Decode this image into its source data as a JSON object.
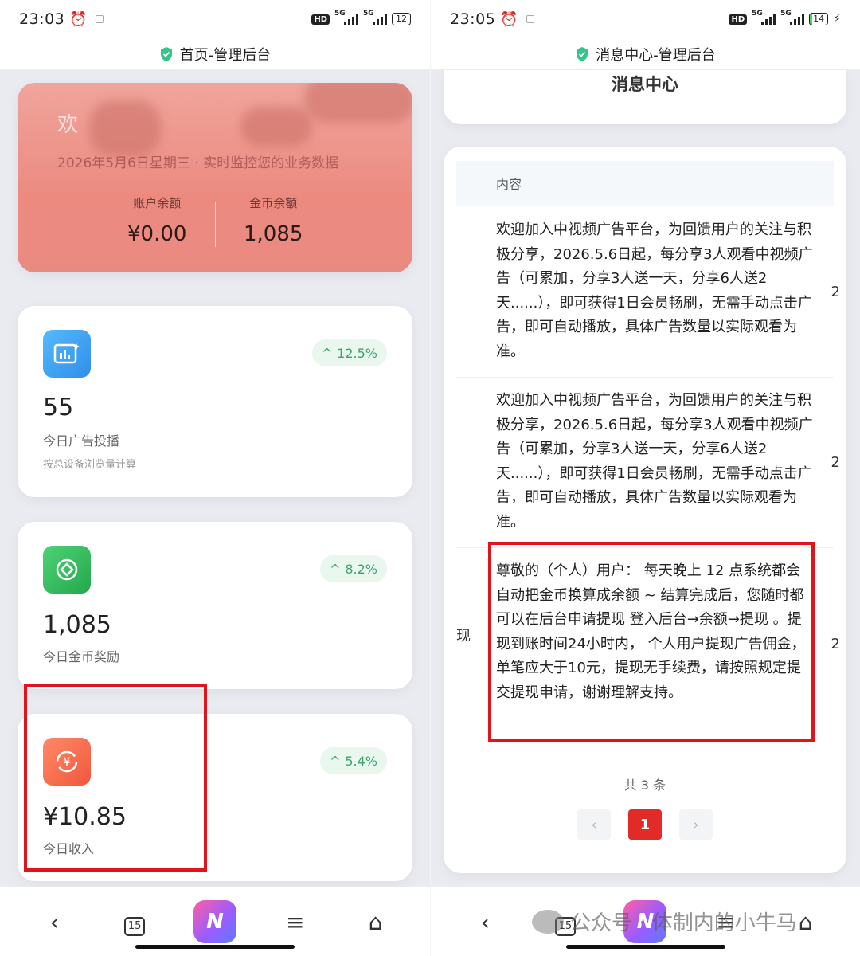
{
  "left": {
    "status": {
      "time": "23:03",
      "battery": "12"
    },
    "title": "首页-管理后台",
    "welcome": {
      "greeting": "欢",
      "date_line": "2026年5月6日星期三 · 实时监控您的业务数据",
      "account_label": "账户余额",
      "account_value": "¥0.00",
      "coin_label": "金币余额",
      "coin_value": "1,085"
    },
    "cards": [
      {
        "value": "55",
        "label": "今日广告投播",
        "sub": "按总设备浏览量计算",
        "trend": "12.5%",
        "icon": "chart-icon",
        "color": "#3aa3f2"
      },
      {
        "value": "1,085",
        "label": "今日金币奖励",
        "sub": "",
        "trend": "8.2%",
        "icon": "coin-target-icon",
        "color": "#2fbf5a"
      },
      {
        "value": "¥10.85",
        "label": "今日收入",
        "sub": "",
        "trend": "5.4%",
        "icon": "yuan-exchange-icon",
        "color": "#f36d4f"
      }
    ]
  },
  "right": {
    "status": {
      "time": "23:05",
      "battery": "14"
    },
    "title": "消息中心-管理后台",
    "header": "消息中心",
    "table_header": "内容",
    "messages": [
      {
        "text": "欢迎加入中视频广告平台，为回馈用户的关注与积极分享，2026.5.6日起，每分享3人观看中视频广告（可累加，分享3人送一天，分享6人送2天......），即可获得1日会员畅刷，无需手动点击广告，即可自动播放，具体广告数量以实际观看为准。",
        "side": "2"
      },
      {
        "text": "欢迎加入中视频广告平台，为回馈用户的关注与积极分享，2026.5.6日起，每分享3人观看中视频广告（可累加，分享3人送一天，分享6人送2天......），即可获得1日会员畅刷，无需手动点击广告，即可自动播放，具体广告数量以实际观看为准。",
        "side": "2"
      },
      {
        "text": "尊敬的（个人）用户： 每天晚上 12 点系统都会自动把金币换算成余额 ~ 结算完成后，您随时都可以在后台申请提现 登入后台→余额→提现 。提现到账时间24小时内， 个人用户提现广告佣金，单笔应大于10元，提现无手续费，请按照规定提交提现申请，谢谢理解支持。",
        "side": "2",
        "left_side": "现"
      }
    ],
    "total": "共 3 条",
    "page": "1"
  },
  "nav": {
    "tabs_count": "15",
    "app_letter": "N"
  },
  "watermark": "公众号 · 体制内的小牛马"
}
